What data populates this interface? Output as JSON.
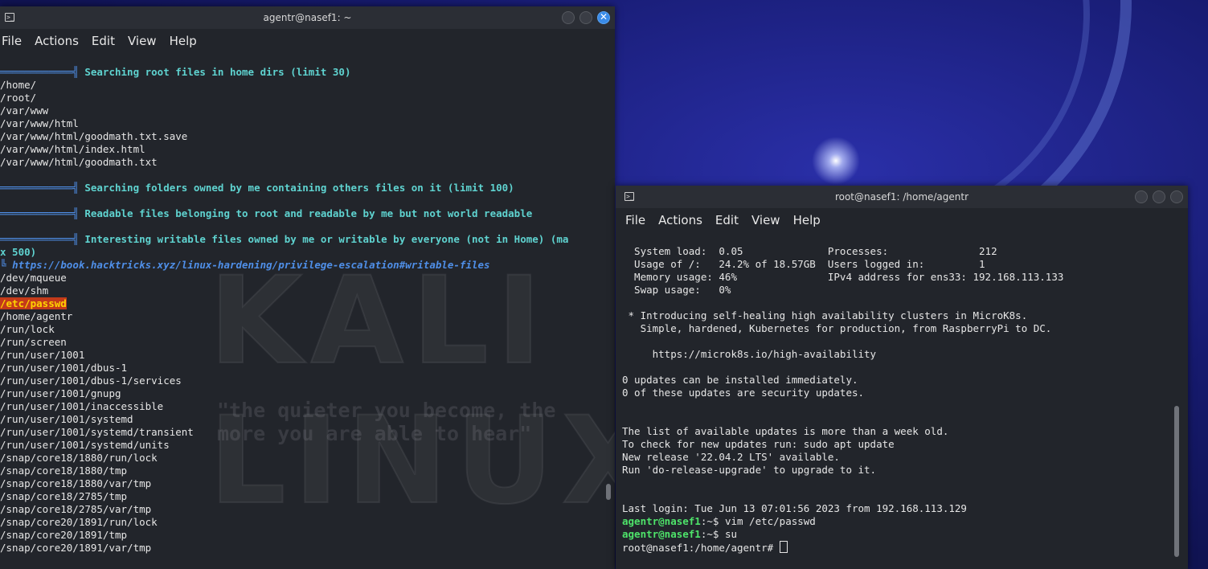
{
  "left_window": {
    "title": "agentr@nasef1: ~",
    "menu": [
      "File",
      "Actions",
      "Edit",
      "View",
      "Help"
    ],
    "lines": [
      {
        "t": "",
        "hdr": "Searching root files in home dirs (limit 30)"
      },
      {
        "t": "/home/"
      },
      {
        "t": "/root/"
      },
      {
        "t": "/var/www"
      },
      {
        "t": "/var/www/html"
      },
      {
        "t": "/var/www/html/goodmath.txt.save"
      },
      {
        "t": "/var/www/html/index.html"
      },
      {
        "t": "/var/www/html/goodmath.txt"
      },
      {
        "t": ""
      },
      {
        "t": "",
        "hdr": "Searching folders owned by me containing others files on it (limit 100)"
      },
      {
        "t": ""
      },
      {
        "t": "",
        "hdr": "Readable files belonging to root and readable by me but not world readable"
      },
      {
        "t": ""
      },
      {
        "t": "",
        "hdr": "Interesting writable files owned by me or writable by everyone (not in Home) (ma"
      },
      {
        "t": "x 500)",
        "hdrcont": true
      },
      {
        "t": "",
        "link": "https://book.hacktricks.xyz/linux-hardening/privilege-escalation#writable-files"
      },
      {
        "t": "/dev/mqueue"
      },
      {
        "t": "/dev/shm"
      },
      {
        "t": "/etc/passwd",
        "highlight": true
      },
      {
        "t": "/home/agentr"
      },
      {
        "t": "/run/lock"
      },
      {
        "t": "/run/screen"
      },
      {
        "t": "/run/user/1001"
      },
      {
        "t": "/run/user/1001/dbus-1"
      },
      {
        "t": "/run/user/1001/dbus-1/services"
      },
      {
        "t": "/run/user/1001/gnupg"
      },
      {
        "t": "/run/user/1001/inaccessible"
      },
      {
        "t": "/run/user/1001/systemd"
      },
      {
        "t": "/run/user/1001/systemd/transient"
      },
      {
        "t": "/run/user/1001/systemd/units"
      },
      {
        "t": "/snap/core18/1880/run/lock"
      },
      {
        "t": "/snap/core18/1880/tmp"
      },
      {
        "t": "/snap/core18/1880/var/tmp"
      },
      {
        "t": "/snap/core18/2785/tmp"
      },
      {
        "t": "/snap/core18/2785/var/tmp"
      },
      {
        "t": "/snap/core20/1891/run/lock"
      },
      {
        "t": "/snap/core20/1891/tmp"
      },
      {
        "t": "/snap/core20/1891/var/tmp"
      }
    ],
    "watermark": {
      "logo": "KALI LINUX",
      "quote": "\"the quieter you become, the more you are able to hear\""
    }
  },
  "right_window": {
    "title": "root@nasef1: /home/agentr",
    "menu": [
      "File",
      "Actions",
      "Edit",
      "View",
      "Help"
    ],
    "lines": [
      {
        "t": "  System load:  0.05              Processes:               212"
      },
      {
        "t": "  Usage of /:   24.2% of 18.57GB  Users logged in:         1"
      },
      {
        "t": "  Memory usage: 46%               IPv4 address for ens33: 192.168.113.133"
      },
      {
        "t": "  Swap usage:   0%"
      },
      {
        "t": ""
      },
      {
        "t": " * Introducing self-healing high availability clusters in MicroK8s."
      },
      {
        "t": "   Simple, hardened, Kubernetes for production, from RaspberryPi to DC."
      },
      {
        "t": ""
      },
      {
        "t": "     https://microk8s.io/high-availability"
      },
      {
        "t": ""
      },
      {
        "t": "0 updates can be installed immediately."
      },
      {
        "t": "0 of these updates are security updates."
      },
      {
        "t": ""
      },
      {
        "t": ""
      },
      {
        "t": "The list of available updates is more than a week old."
      },
      {
        "t": "To check for new updates run: sudo apt update"
      },
      {
        "t": "New release '22.04.2 LTS' available."
      },
      {
        "t": "Run 'do-release-upgrade' to upgrade to it."
      },
      {
        "t": ""
      },
      {
        "t": ""
      },
      {
        "t": "Last login: Tue Jun 13 07:01:56 2023 from 192.168.113.129"
      },
      {
        "prompt": "agentr@nasef1",
        "rest": ":~$ vim /etc/passwd"
      },
      {
        "prompt": "agentr@nasef1",
        "rest": ":~$ su"
      },
      {
        "t": "root@nasef1:/home/agentr# ",
        "cursor": true
      }
    ]
  },
  "colors": {
    "terminal_bg": "#22252b",
    "header_cyan": "#5fd3d0",
    "link_blue": "#4f8fe8",
    "highlight_red": "#c33a1a",
    "highlight_yellow": "#ffd400",
    "prompt_green": "#4ee36a"
  }
}
